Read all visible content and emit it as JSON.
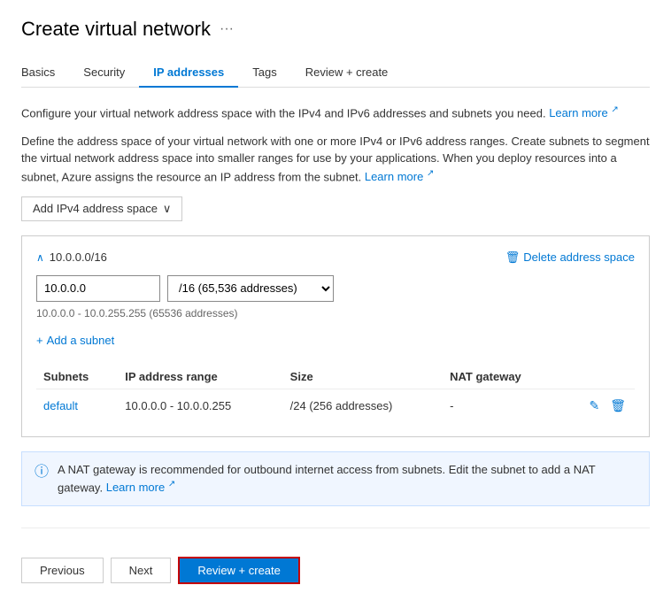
{
  "page": {
    "title": "Create virtual network",
    "more_label": "···"
  },
  "tabs": [
    {
      "id": "basics",
      "label": "Basics",
      "active": false
    },
    {
      "id": "security",
      "label": "Security",
      "active": false
    },
    {
      "id": "ip-addresses",
      "label": "IP addresses",
      "active": true
    },
    {
      "id": "tags",
      "label": "Tags",
      "active": false
    },
    {
      "id": "review-create",
      "label": "Review + create",
      "active": false
    }
  ],
  "description1": "Configure your virtual network address space with the IPv4 and IPv6 addresses and subnets you need.",
  "description1_link": "Learn more",
  "description2": "Define the address space of your virtual network with one or more IPv4 or IPv6 address ranges. Create subnets to segment the virtual network address space into smaller ranges for use by your applications. When you deploy resources into a subnet, Azure assigns the resource an IP address from the subnet.",
  "description2_link": "Learn more",
  "add_ipv4_btn": "Add IPv4 address space",
  "address_space": {
    "label": "10.0.0.0/16",
    "input_value": "10.0.0.0",
    "cidr_value": "/16 (65,536 addresses)",
    "range_hint": "10.0.0.0 - 10.0.255.255 (65536 addresses)",
    "delete_label": "Delete address space",
    "add_subnet_label": "Add a subnet"
  },
  "subnets_table": {
    "headers": [
      "Subnets",
      "IP address range",
      "Size",
      "NAT gateway"
    ],
    "rows": [
      {
        "name": "default",
        "ip_range": "10.0.0.0 - 10.0.0.255",
        "size": "/24 (256 addresses)",
        "nat_gateway": "-"
      }
    ]
  },
  "nat_warning": "A NAT gateway is recommended for outbound internet access from subnets. Edit the subnet to add a NAT gateway.",
  "nat_learn_more": "Learn more",
  "footer": {
    "previous": "Previous",
    "next": "Next",
    "review_create": "Review + create"
  },
  "icons": {
    "more": "···",
    "collapse": "∧",
    "trash": "🗑",
    "edit": "✎",
    "plus": "+",
    "info": "ⓘ",
    "external_link": "↗",
    "dropdown_arrow": "∨"
  }
}
